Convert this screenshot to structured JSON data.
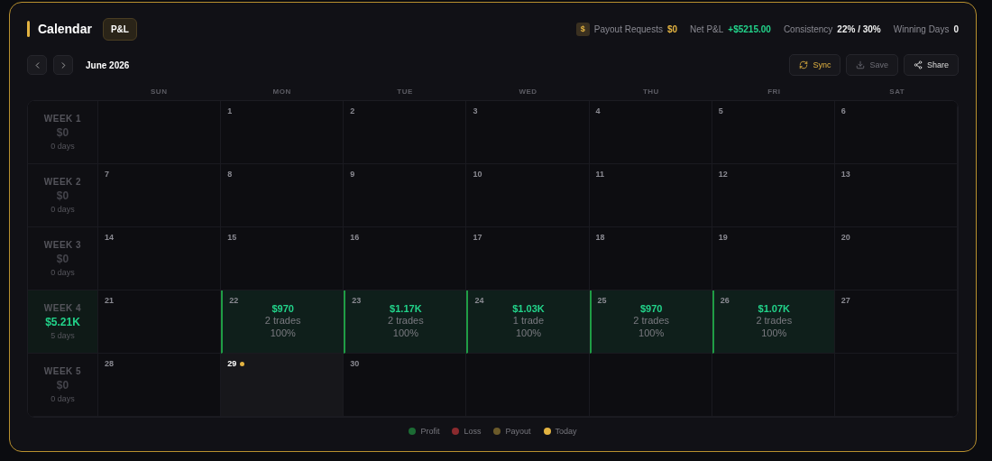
{
  "header": {
    "title": "Calendar",
    "badge": "P&L",
    "stats": [
      {
        "kind": "payout",
        "icon": "$",
        "label": "Payout Requests",
        "value": "$0"
      },
      {
        "kind": "profit",
        "label": "Net P&L",
        "value": "+$5215.00"
      },
      {
        "kind": "plain",
        "label": "Consistency",
        "value": "22% / 30%"
      },
      {
        "kind": "plain",
        "label": "Winning Days",
        "value": "0"
      }
    ]
  },
  "toolbar": {
    "month": "June 2026",
    "buttons": [
      {
        "kind": "sync",
        "label": "Sync",
        "disabled": false
      },
      {
        "kind": "save",
        "label": "Save",
        "disabled": true
      },
      {
        "kind": "share",
        "label": "Share",
        "disabled": false
      }
    ]
  },
  "weekdays": [
    "SUN",
    "MON",
    "TUE",
    "WED",
    "THU",
    "FRI",
    "SAT"
  ],
  "weeks": [
    {
      "label": "WEEK 1",
      "amount": "$0",
      "days_count": "0 days",
      "profit": false,
      "days": [
        {
          "kind": "blank"
        },
        {
          "kind": "day",
          "day": "1"
        },
        {
          "kind": "day",
          "day": "2"
        },
        {
          "kind": "day",
          "day": "3"
        },
        {
          "kind": "day",
          "day": "4"
        },
        {
          "kind": "day",
          "day": "5"
        },
        {
          "kind": "day",
          "day": "6"
        }
      ]
    },
    {
      "label": "WEEK 2",
      "amount": "$0",
      "days_count": "0 days",
      "profit": false,
      "days": [
        {
          "kind": "day",
          "day": "7"
        },
        {
          "kind": "day",
          "day": "8"
        },
        {
          "kind": "day",
          "day": "9"
        },
        {
          "kind": "day",
          "day": "10"
        },
        {
          "kind": "day",
          "day": "11"
        },
        {
          "kind": "day",
          "day": "12"
        },
        {
          "kind": "day",
          "day": "13"
        }
      ]
    },
    {
      "label": "WEEK 3",
      "amount": "$0",
      "days_count": "0 days",
      "profit": false,
      "days": [
        {
          "kind": "day",
          "day": "14"
        },
        {
          "kind": "day",
          "day": "15"
        },
        {
          "kind": "day",
          "day": "16"
        },
        {
          "kind": "day",
          "day": "17"
        },
        {
          "kind": "day",
          "day": "18"
        },
        {
          "kind": "day",
          "day": "19"
        },
        {
          "kind": "day",
          "day": "20"
        }
      ]
    },
    {
      "label": "WEEK 4",
      "amount": "$5.21K",
      "days_count": "5 days",
      "profit": true,
      "days": [
        {
          "kind": "day",
          "day": "21"
        },
        {
          "kind": "profit",
          "day": "22",
          "pnl": "$970",
          "trades": "2 trades",
          "rate": "100%"
        },
        {
          "kind": "profit",
          "day": "23",
          "pnl": "$1.17K",
          "trades": "2 trades",
          "rate": "100%"
        },
        {
          "kind": "profit",
          "day": "24",
          "pnl": "$1.03K",
          "trades": "1 trade",
          "rate": "100%"
        },
        {
          "kind": "profit",
          "day": "25",
          "pnl": "$970",
          "trades": "2 trades",
          "rate": "100%"
        },
        {
          "kind": "profit",
          "day": "26",
          "pnl": "$1.07K",
          "trades": "2 trades",
          "rate": "100%"
        },
        {
          "kind": "day",
          "day": "27"
        }
      ]
    },
    {
      "label": "WEEK 5",
      "amount": "$0",
      "days_count": "0 days",
      "profit": false,
      "days": [
        {
          "kind": "day",
          "day": "28"
        },
        {
          "kind": "today",
          "day": "29"
        },
        {
          "kind": "day",
          "day": "30"
        },
        {
          "kind": "blank"
        },
        {
          "kind": "blank"
        },
        {
          "kind": "blank"
        },
        {
          "kind": "blank"
        }
      ]
    }
  ],
  "legend": [
    {
      "label": "Profit",
      "color": "#1c6b34"
    },
    {
      "label": "Loss",
      "color": "#8b2a2e"
    },
    {
      "label": "Payout",
      "color": "#6b5a2a"
    },
    {
      "label": "Today",
      "color": "#e3b341"
    }
  ]
}
